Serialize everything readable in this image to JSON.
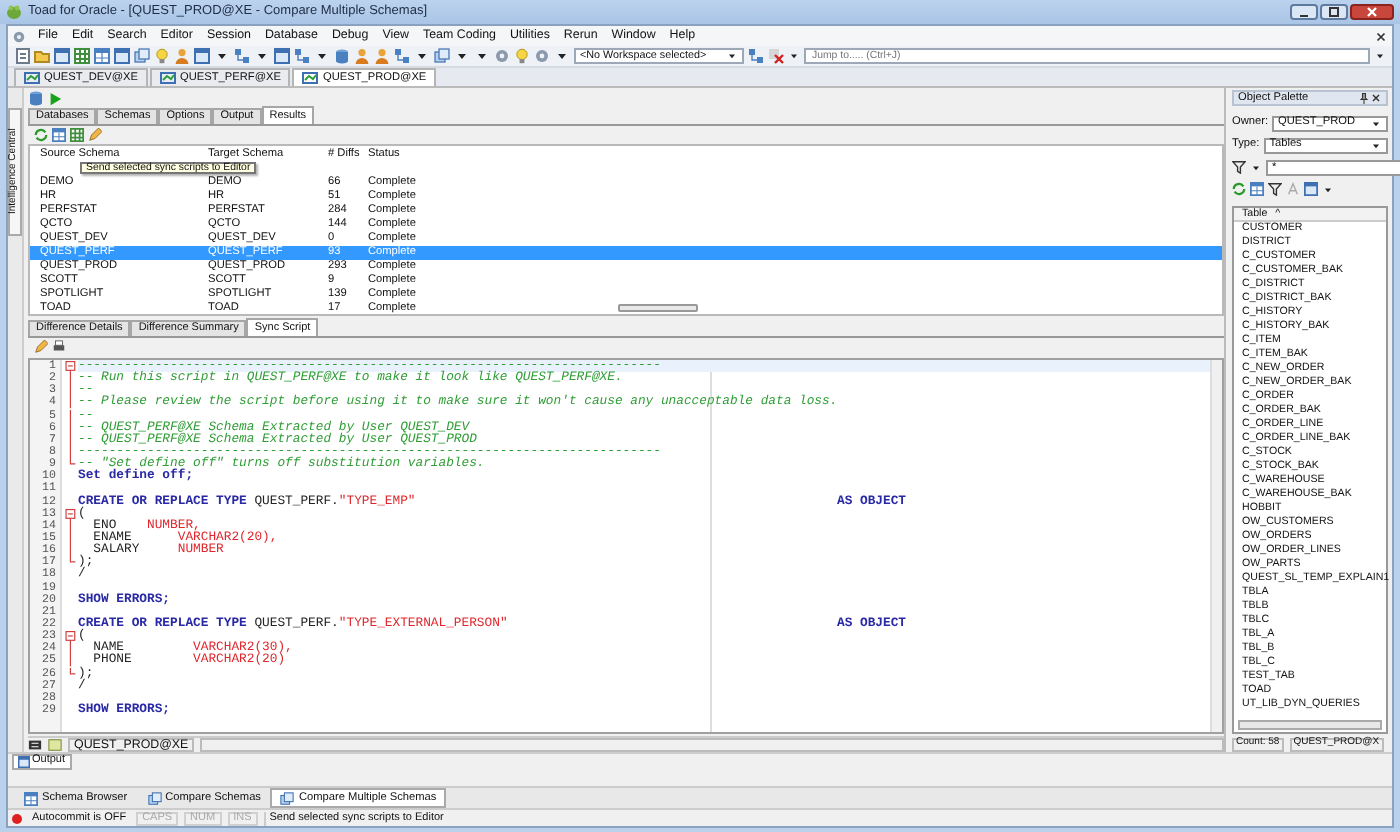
{
  "window": {
    "title": "Toad for Oracle - [QUEST_PROD@XE - Compare Multiple Schemas]"
  },
  "menu": [
    "File",
    "Edit",
    "Search",
    "Editor",
    "Session",
    "Database",
    "Debug",
    "View",
    "Team Coding",
    "Utilities",
    "Rerun",
    "Window",
    "Help"
  ],
  "toolbar": {
    "workspace": "<No Workspace selected>",
    "jump_placeholder": "Jump to..... (Ctrl+J)"
  },
  "connections": [
    {
      "label": "QUEST_DEV@XE",
      "selected": false
    },
    {
      "label": "QUEST_PERF@XE",
      "selected": false
    },
    {
      "label": "QUEST_PROD@XE",
      "selected": true
    }
  ],
  "side_tab": "Intelligence Central",
  "main_tabs": [
    {
      "label": "Databases",
      "selected": false
    },
    {
      "label": "Schemas",
      "selected": false
    },
    {
      "label": "Options",
      "selected": false
    },
    {
      "label": "Output",
      "selected": false
    },
    {
      "label": "Results",
      "selected": true
    }
  ],
  "results": {
    "columns": [
      "Source Schema",
      "Target Schema",
      "# Diffs",
      "Status"
    ],
    "rows": [
      {
        "cells": [
          "DEMO",
          "DEMO",
          "66",
          "Complete"
        ],
        "selected": false
      },
      {
        "cells": [
          "HR",
          "HR",
          "51",
          "Complete"
        ],
        "selected": false
      },
      {
        "cells": [
          "PERFSTAT",
          "PERFSTAT",
          "284",
          "Complete"
        ],
        "selected": false
      },
      {
        "cells": [
          "QCTO",
          "QCTO",
          "144",
          "Complete"
        ],
        "selected": false
      },
      {
        "cells": [
          "QUEST_DEV",
          "QUEST_DEV",
          "0",
          "Complete"
        ],
        "selected": false
      },
      {
        "cells": [
          "QUEST_PERF",
          "QUEST_PERF",
          "93",
          "Complete"
        ],
        "selected": true
      },
      {
        "cells": [
          "QUEST_PROD",
          "QUEST_PROD",
          "293",
          "Complete"
        ],
        "selected": false
      },
      {
        "cells": [
          "SCOTT",
          "SCOTT",
          "9",
          "Complete"
        ],
        "selected": false
      },
      {
        "cells": [
          "SPOTLIGHT",
          "SPOTLIGHT",
          "139",
          "Complete"
        ],
        "selected": false
      },
      {
        "cells": [
          "TOAD",
          "TOAD",
          "17",
          "Complete"
        ],
        "selected": false
      }
    ],
    "tooltip": "Send selected sync scripts to Editor"
  },
  "detail_tabs": [
    {
      "label": "Difference Details",
      "selected": false
    },
    {
      "label": "Difference Summary",
      "selected": false
    },
    {
      "label": "Sync Script",
      "selected": true
    }
  ],
  "script": {
    "lines": [
      {
        "number": "1",
        "fold_start": true,
        "current": true,
        "tokens": [
          {
            "kind": "comment",
            "text": "----------------------------------------------------------------------------"
          }
        ]
      },
      {
        "number": "2",
        "in_fold": true,
        "tokens": [
          {
            "kind": "comment",
            "text": "-- Run this script in QUEST_PERF@XE to make it look like QUEST_PERF@XE."
          }
        ]
      },
      {
        "number": "3",
        "in_fold": true,
        "tokens": [
          {
            "kind": "comment",
            "text": "--"
          }
        ]
      },
      {
        "number": "4",
        "in_fold": true,
        "tokens": [
          {
            "kind": "comment",
            "text": "-- Please review the script before using it to make sure it won't cause any unacceptable data loss."
          }
        ]
      },
      {
        "number": "5",
        "in_fold": true,
        "tokens": [
          {
            "kind": "comment",
            "text": "--"
          }
        ]
      },
      {
        "number": "6",
        "in_fold": true,
        "tokens": [
          {
            "kind": "comment",
            "text": "-- QUEST_PERF@XE Schema Extracted by User QUEST_DEV"
          }
        ]
      },
      {
        "number": "7",
        "in_fold": true,
        "tokens": [
          {
            "kind": "comment",
            "text": "-- QUEST_PERF@XE Schema Extracted by User QUEST_PROD"
          }
        ]
      },
      {
        "number": "8",
        "in_fold": true,
        "tokens": [
          {
            "kind": "comment",
            "text": "----------------------------------------------------------------------------"
          }
        ]
      },
      {
        "number": "9",
        "fold_end": true,
        "tokens": [
          {
            "kind": "comment",
            "text": "-- \"Set define off\" turns off substitution variables."
          }
        ]
      },
      {
        "number": "10",
        "tokens": [
          {
            "kind": "keyword",
            "text": "Set define off;"
          }
        ]
      },
      {
        "number": "11"
      },
      {
        "number": "12",
        "tokens": [
          {
            "kind": "keyword",
            "text": "CREATE OR REPLACE TYPE"
          },
          {
            "kind": "plain",
            "text": " QUEST_PERF."
          },
          {
            "kind": "string",
            "text": "\"TYPE_EMP\""
          }
        ],
        "tail": "AS OBJECT"
      },
      {
        "number": "13",
        "fold_start": true,
        "tokens": [
          {
            "kind": "plain",
            "text": "("
          }
        ]
      },
      {
        "number": "14",
        "in_fold": true,
        "tokens": [
          {
            "kind": "plain",
            "text": "  ENO    "
          },
          {
            "kind": "type",
            "text": "NUMBER,"
          }
        ]
      },
      {
        "number": "15",
        "in_fold": true,
        "tokens": [
          {
            "kind": "plain",
            "text": "  ENAME      "
          },
          {
            "kind": "type",
            "text": "VARCHAR2(20),"
          }
        ]
      },
      {
        "number": "16",
        "in_fold": true,
        "tokens": [
          {
            "kind": "plain",
            "text": "  SALARY     "
          },
          {
            "kind": "type",
            "text": "NUMBER"
          }
        ]
      },
      {
        "number": "17",
        "fold_end": true,
        "tokens": [
          {
            "kind": "plain",
            "text": ");"
          }
        ]
      },
      {
        "number": "18",
        "tokens": [
          {
            "kind": "plain",
            "text": "/"
          }
        ]
      },
      {
        "number": "19"
      },
      {
        "number": "20",
        "tokens": [
          {
            "kind": "keyword",
            "text": "SHOW ERRORS;"
          }
        ]
      },
      {
        "number": "21"
      },
      {
        "number": "22",
        "tokens": [
          {
            "kind": "keyword",
            "text": "CREATE OR REPLACE TYPE"
          },
          {
            "kind": "plain",
            "text": " QUEST_PERF."
          },
          {
            "kind": "string",
            "text": "\"TYPE_EXTERNAL_PERSON\""
          }
        ],
        "tail": "AS OBJECT"
      },
      {
        "number": "23",
        "fold_start": true,
        "tokens": [
          {
            "kind": "plain",
            "text": "("
          }
        ]
      },
      {
        "number": "24",
        "in_fold": true,
        "tokens": [
          {
            "kind": "plain",
            "text": "  NAME         "
          },
          {
            "kind": "type",
            "text": "VARCHAR2(30),"
          }
        ]
      },
      {
        "number": "25",
        "in_fold": true,
        "tokens": [
          {
            "kind": "plain",
            "text": "  PHONE        "
          },
          {
            "kind": "type",
            "text": "VARCHAR2(20)"
          }
        ]
      },
      {
        "number": "26",
        "fold_end": true,
        "tokens": [
          {
            "kind": "plain",
            "text": ");"
          }
        ]
      },
      {
        "number": "27",
        "tokens": [
          {
            "kind": "plain",
            "text": "/"
          }
        ]
      },
      {
        "number": "28"
      },
      {
        "number": "29",
        "tokens": [
          {
            "kind": "keyword",
            "text": "SHOW ERRORS;"
          }
        ]
      }
    ]
  },
  "editor_status": {
    "connection": "QUEST_PROD@XE"
  },
  "palette": {
    "title": "Object Palette",
    "owner_label": "Owner:",
    "owner": "QUEST_PROD",
    "type_label": "Type:",
    "type": "Tables",
    "filter": "*",
    "column": "Table",
    "sort_mark": "^",
    "items": [
      "CUSTOMER",
      "DISTRICT",
      "C_CUSTOMER",
      "C_CUSTOMER_BAK",
      "C_DISTRICT",
      "C_DISTRICT_BAK",
      "C_HISTORY",
      "C_HISTORY_BAK",
      "C_ITEM",
      "C_ITEM_BAK",
      "C_NEW_ORDER",
      "C_NEW_ORDER_BAK",
      "C_ORDER",
      "C_ORDER_BAK",
      "C_ORDER_LINE",
      "C_ORDER_LINE_BAK",
      "C_STOCK",
      "C_STOCK_BAK",
      "C_WAREHOUSE",
      "C_WAREHOUSE_BAK",
      "HOBBIT",
      "OW_CUSTOMERS",
      "OW_ORDERS",
      "OW_ORDER_LINES",
      "OW_PARTS",
      "QUEST_SL_TEMP_EXPLAIN1",
      "TBLA",
      "TBLB",
      "TBLC",
      "TBL_A",
      "TBL_B",
      "TBL_C",
      "TEST_TAB",
      "TOAD",
      "UT_LIB_DYN_QUERIES"
    ],
    "count": "Count: 58",
    "connection": "QUEST_PROD@X"
  },
  "output_tab": {
    "label": "Output",
    "selected": true
  },
  "window_tabs": [
    {
      "label": "Schema Browser",
      "selected": false
    },
    {
      "label": "Compare Schemas",
      "selected": false
    },
    {
      "label": "Compare Multiple Schemas",
      "selected": true
    }
  ],
  "status_bar": [
    {
      "kind": "autocommit",
      "text": "Autocommit is OFF",
      "color": "#e02020"
    },
    {
      "kind": "key",
      "text": "CAPS",
      "disabled": true
    },
    {
      "kind": "key",
      "text": "NUM",
      "disabled": true
    },
    {
      "kind": "key",
      "text": "INS",
      "disabled": true
    },
    {
      "kind": "message",
      "text": "Send selected sync scripts to Editor"
    }
  ]
}
